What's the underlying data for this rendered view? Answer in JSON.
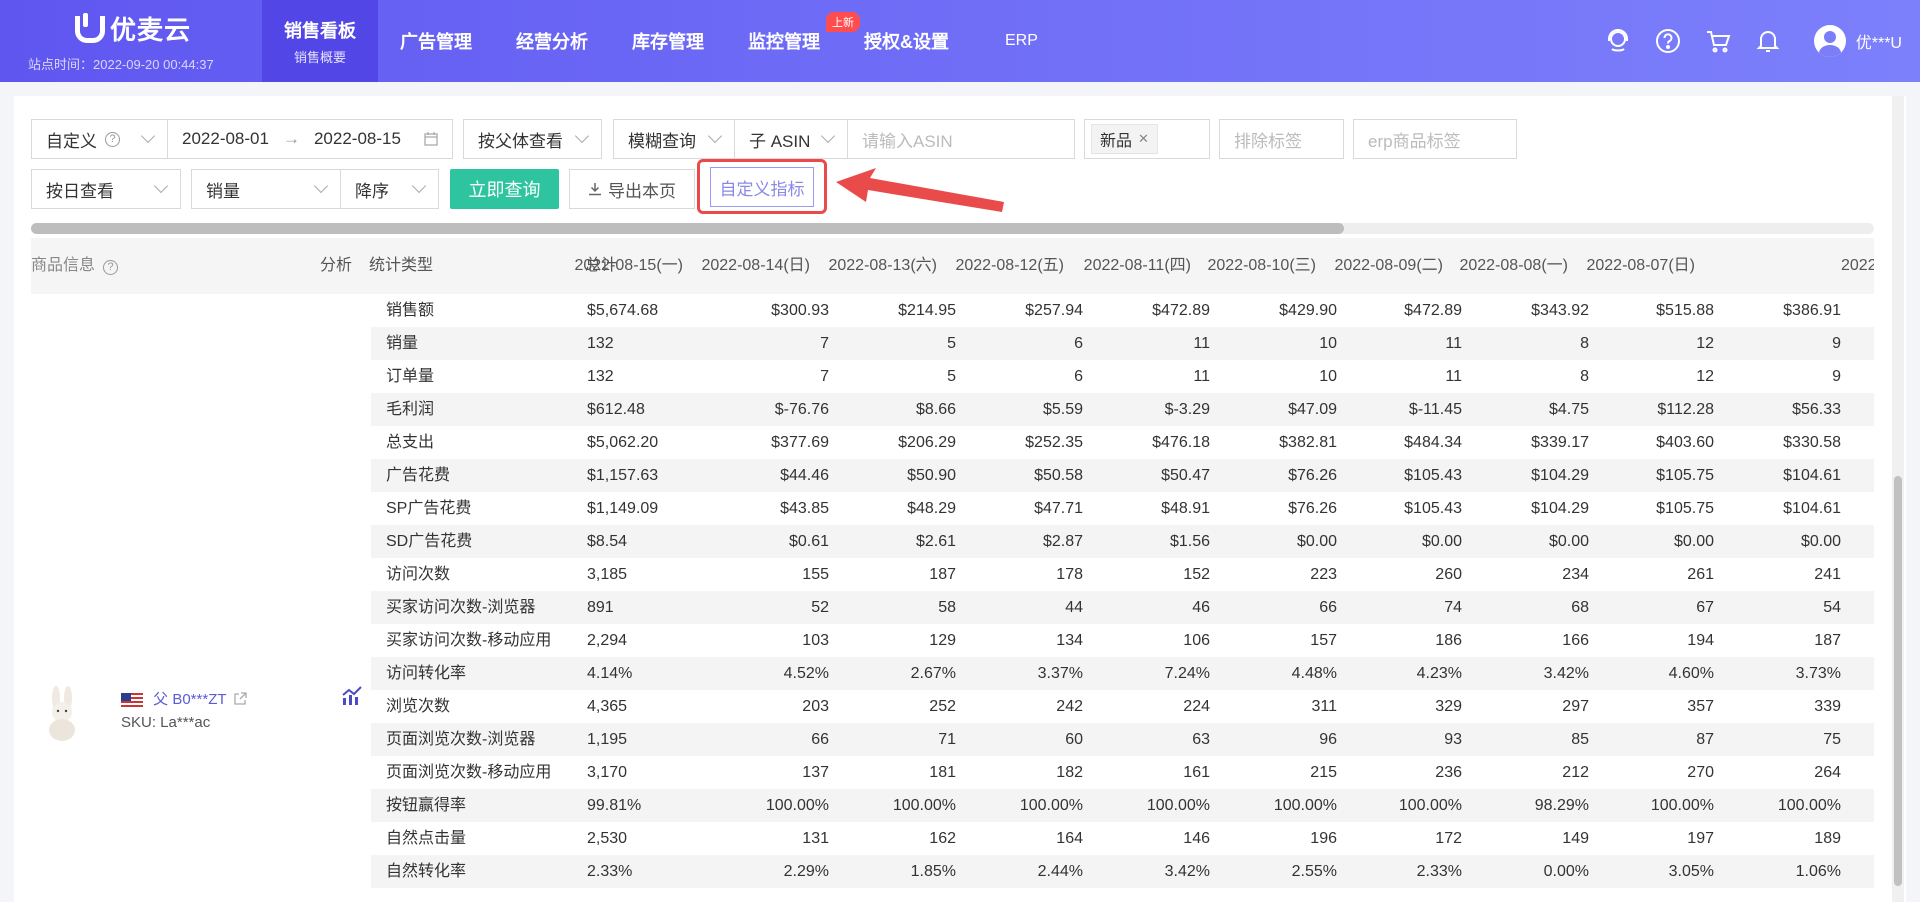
{
  "brand": {
    "name": "优麦云",
    "site_time": "站点时间：2022-09-20 00:44:37"
  },
  "nav": {
    "items": [
      {
        "label": "销售看板",
        "sub": "销售概要",
        "active": true
      },
      {
        "label": "广告管理"
      },
      {
        "label": "经营分析"
      },
      {
        "label": "库存管理"
      },
      {
        "label": "监控管理",
        "badge": "上新"
      },
      {
        "label": "授权&设置"
      },
      {
        "label": "ERP"
      }
    ],
    "username": "优***U"
  },
  "filters": {
    "range_type": "自定义",
    "date_start": "2022-08-01",
    "date_sep": "→",
    "date_end": "2022-08-15",
    "view_by_parent": "按父体查看",
    "match_mode": "模糊查询",
    "asin_type": "子 ASIN",
    "asin_placeholder": "请输入ASIN",
    "tag_value": "新品",
    "exclude_tag_placeholder": "排除标签",
    "erp_tag_placeholder": "erp商品标签",
    "view_by_day": "按日查看",
    "sort_field": "销量",
    "sort_order": "降序",
    "query_button": "立即查询",
    "export_button": "导出本页",
    "custom_metric_button": "自定义指标"
  },
  "table": {
    "headers": {
      "product": "商品信息",
      "analysis": "分析",
      "stat_type": "统计类型",
      "total": "总计",
      "dates": [
        "2022-08-15(一)",
        "2022-08-14(日)",
        "2022-08-13(六)",
        "2022-08-12(五)",
        "2022-08-11(四)",
        "2022-08-10(三)",
        "2022-08-09(二)",
        "2022-08-08(一)",
        "2022-08-07(日)",
        "2022"
      ]
    },
    "product": {
      "asin": "父 B0***ZT",
      "sku": "SKU: La***ac"
    },
    "rows": [
      {
        "type": "销售额",
        "total": "$5,674.68",
        "values": [
          "$300.93",
          "$214.95",
          "$257.94",
          "$472.89",
          "$429.90",
          "$472.89",
          "$343.92",
          "$515.88",
          "$386.91"
        ]
      },
      {
        "type": "销量",
        "total": "132",
        "values": [
          "7",
          "5",
          "6",
          "11",
          "10",
          "11",
          "8",
          "12",
          "9"
        ]
      },
      {
        "type": "订单量",
        "total": "132",
        "values": [
          "7",
          "5",
          "6",
          "11",
          "10",
          "11",
          "8",
          "12",
          "9"
        ]
      },
      {
        "type": "毛利润",
        "total": "$612.48",
        "values": [
          "$-76.76",
          "$8.66",
          "$5.59",
          "$-3.29",
          "$47.09",
          "$-11.45",
          "$4.75",
          "$112.28",
          "$56.33"
        ]
      },
      {
        "type": "总支出",
        "total": "$5,062.20",
        "values": [
          "$377.69",
          "$206.29",
          "$252.35",
          "$476.18",
          "$382.81",
          "$484.34",
          "$339.17",
          "$403.60",
          "$330.58"
        ]
      },
      {
        "type": "广告花费",
        "total": "$1,157.63",
        "values": [
          "$44.46",
          "$50.90",
          "$50.58",
          "$50.47",
          "$76.26",
          "$105.43",
          "$104.29",
          "$105.75",
          "$104.61"
        ]
      },
      {
        "type": "SP广告花费",
        "total": "$1,149.09",
        "values": [
          "$43.85",
          "$48.29",
          "$47.71",
          "$48.91",
          "$76.26",
          "$105.43",
          "$104.29",
          "$105.75",
          "$104.61"
        ]
      },
      {
        "type": "SD广告花费",
        "total": "$8.54",
        "values": [
          "$0.61",
          "$2.61",
          "$2.87",
          "$1.56",
          "$0.00",
          "$0.00",
          "$0.00",
          "$0.00",
          "$0.00"
        ]
      },
      {
        "type": "访问次数",
        "total": "3,185",
        "values": [
          "155",
          "187",
          "178",
          "152",
          "223",
          "260",
          "234",
          "261",
          "241"
        ]
      },
      {
        "type": "买家访问次数-浏览器",
        "total": "891",
        "values": [
          "52",
          "58",
          "44",
          "46",
          "66",
          "74",
          "68",
          "67",
          "54"
        ]
      },
      {
        "type": "买家访问次数-移动应用",
        "total": "2,294",
        "values": [
          "103",
          "129",
          "134",
          "106",
          "157",
          "186",
          "166",
          "194",
          "187"
        ]
      },
      {
        "type": "访问转化率",
        "total": "4.14%",
        "values": [
          "4.52%",
          "2.67%",
          "3.37%",
          "7.24%",
          "4.48%",
          "4.23%",
          "3.42%",
          "4.60%",
          "3.73%"
        ]
      },
      {
        "type": "浏览次数",
        "total": "4,365",
        "values": [
          "203",
          "252",
          "242",
          "224",
          "311",
          "329",
          "297",
          "357",
          "339"
        ]
      },
      {
        "type": "页面浏览次数-浏览器",
        "total": "1,195",
        "values": [
          "66",
          "71",
          "60",
          "63",
          "96",
          "93",
          "85",
          "87",
          "75"
        ]
      },
      {
        "type": "页面浏览次数-移动应用",
        "total": "3,170",
        "values": [
          "137",
          "181",
          "182",
          "161",
          "215",
          "236",
          "212",
          "270",
          "264"
        ]
      },
      {
        "type": "按钮赢得率",
        "total": "99.81%",
        "values": [
          "100.00%",
          "100.00%",
          "100.00%",
          "100.00%",
          "100.00%",
          "100.00%",
          "98.29%",
          "100.00%",
          "100.00%"
        ]
      },
      {
        "type": "自然点击量",
        "total": "2,530",
        "values": [
          "131",
          "162",
          "164",
          "146",
          "196",
          "172",
          "149",
          "197",
          "189"
        ]
      },
      {
        "type": "自然转化率",
        "total": "2.33%",
        "values": [
          "2.29%",
          "1.85%",
          "2.44%",
          "3.42%",
          "2.55%",
          "2.33%",
          "0.00%",
          "3.05%",
          "1.06%"
        ]
      }
    ]
  },
  "colors": {
    "nav_bg": "#6d6af6",
    "primary_button": "#2ec4a0",
    "highlight": "#e94b4b",
    "link": "#5b5bd6"
  }
}
